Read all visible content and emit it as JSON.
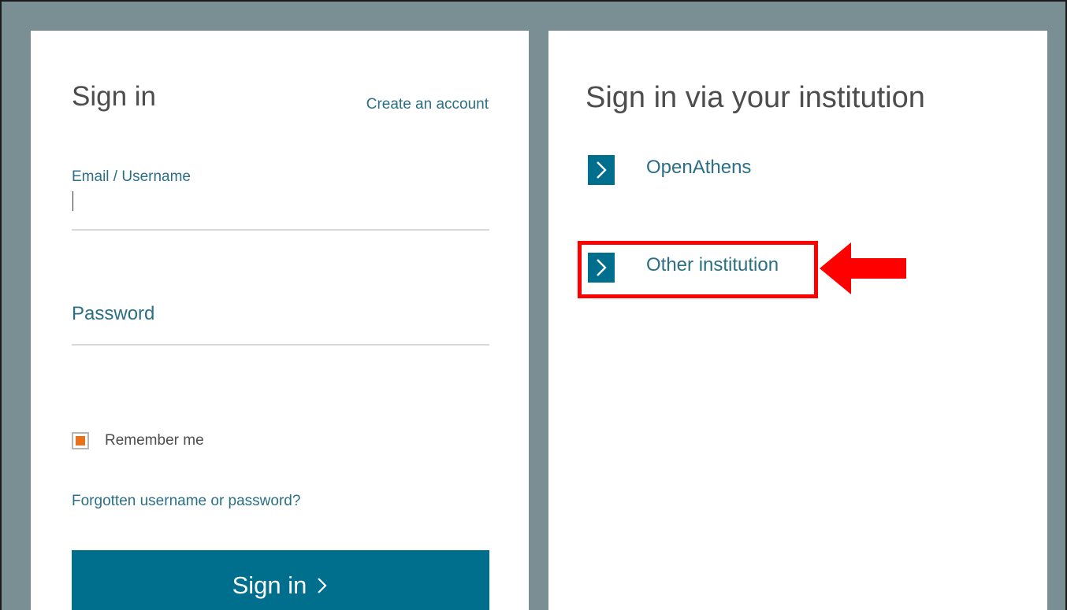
{
  "signin": {
    "title": "Sign in",
    "create_account": "Create an account",
    "email_label": "Email / Username",
    "email_value": "",
    "password_label": "Password",
    "password_value": "",
    "remember_label": "Remember me",
    "remember_checked": true,
    "forgot_link": "Forgotten username or password?",
    "submit_label": "Sign in"
  },
  "institution": {
    "title": "Sign in via your institution",
    "options": [
      {
        "label": "OpenAthens"
      },
      {
        "label": "Other institution"
      }
    ]
  },
  "colors": {
    "background": "#7a8f94",
    "panel": "#ffffff",
    "accent": "#006f8e",
    "link": "#2a6f85",
    "checkbox_fill": "#e9711c",
    "annotation": "#ff0000"
  },
  "icons": {
    "chevron": "chevron-right-icon",
    "annotation_arrow": "left-arrow-icon"
  }
}
